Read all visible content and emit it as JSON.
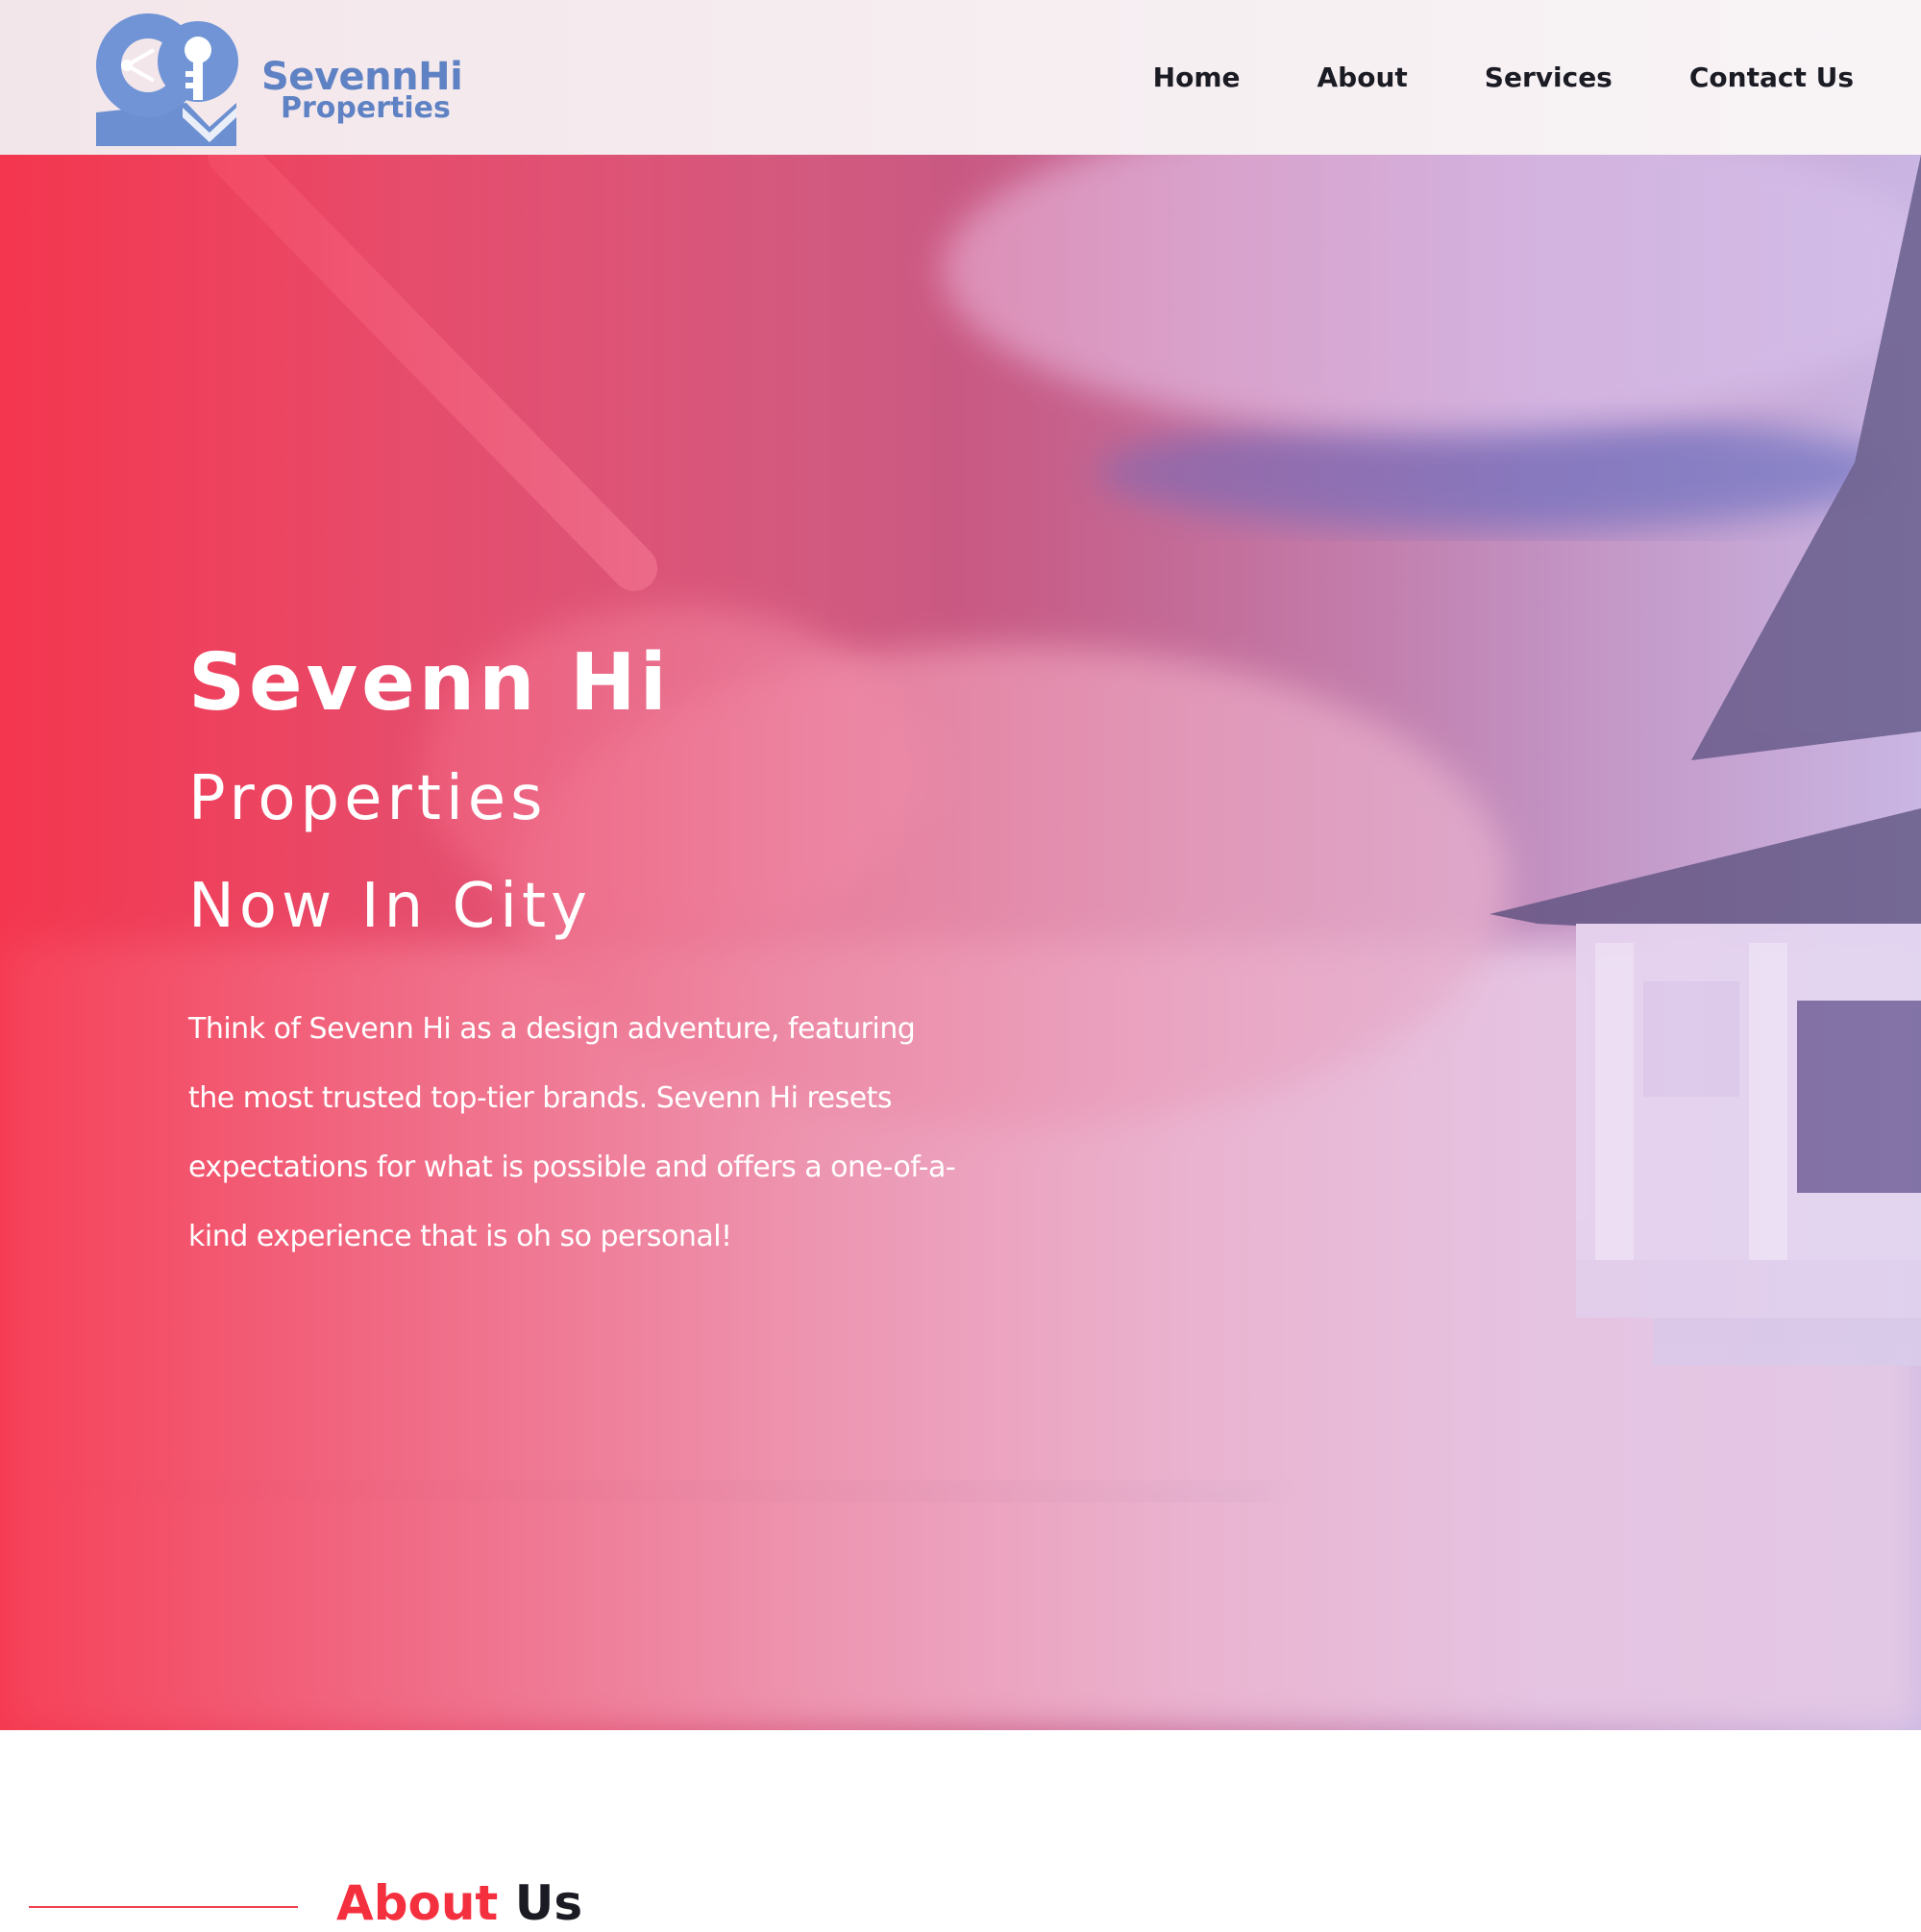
{
  "brand": {
    "name_line1": "SevennHi",
    "name_line2": "Properties",
    "color": "#5f82c4"
  },
  "nav": {
    "items": [
      {
        "label": "Home"
      },
      {
        "label": "About"
      },
      {
        "label": "Services"
      },
      {
        "label": "Contact Us"
      }
    ]
  },
  "hero": {
    "title": "Sevenn Hi",
    "subtitle": "Properties",
    "subtitle2": "Now In City",
    "description": "Think of Sevenn Hi as a design adventure, featuring the most trusted top-tier brands. Sevenn Hi resets expectations for what is possible and offers a one-of-a-kind experience that is oh so personal!",
    "overlay_start": "#f6344c",
    "overlay_end": "#cdb9eb"
  },
  "about": {
    "heading_accent": "About",
    "heading_rest": " Us",
    "accent_color": "#f4303f"
  }
}
